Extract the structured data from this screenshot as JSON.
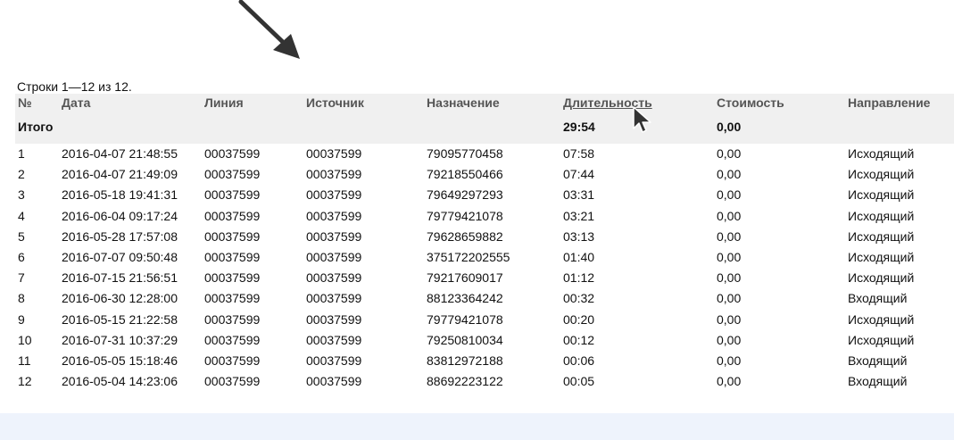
{
  "report": {
    "rows_info": "Строки 1—12 из 12.",
    "columns": [
      "№",
      "Дата",
      "Линия",
      "Источник",
      "Назначение",
      "Длительность",
      "Стоимость",
      "Направление"
    ],
    "sorted_by": "Длительность",
    "totals": {
      "label": "Итого",
      "duration": "29:54",
      "cost": "0,00"
    },
    "rows": [
      {
        "num": "1",
        "date": "2016-04-07 21:48:55",
        "line": "00037599",
        "source": "00037599",
        "dest": "79095770458",
        "duration": "07:58",
        "cost": "0,00",
        "direction": "Исходящий"
      },
      {
        "num": "2",
        "date": "2016-04-07 21:49:09",
        "line": "00037599",
        "source": "00037599",
        "dest": "79218550466",
        "duration": "07:44",
        "cost": "0,00",
        "direction": "Исходящий"
      },
      {
        "num": "3",
        "date": "2016-05-18 19:41:31",
        "line": "00037599",
        "source": "00037599",
        "dest": "79649297293",
        "duration": "03:31",
        "cost": "0,00",
        "direction": "Исходящий"
      },
      {
        "num": "4",
        "date": "2016-06-04 09:17:24",
        "line": "00037599",
        "source": "00037599",
        "dest": "79779421078",
        "duration": "03:21",
        "cost": "0,00",
        "direction": "Исходящий"
      },
      {
        "num": "5",
        "date": "2016-05-28 17:57:08",
        "line": "00037599",
        "source": "00037599",
        "dest": "79628659882",
        "duration": "03:13",
        "cost": "0,00",
        "direction": "Исходящий"
      },
      {
        "num": "6",
        "date": "2016-07-07 09:50:48",
        "line": "00037599",
        "source": "00037599",
        "dest": "375172202555",
        "duration": "01:40",
        "cost": "0,00",
        "direction": "Исходящий"
      },
      {
        "num": "7",
        "date": "2016-07-15 21:56:51",
        "line": "00037599",
        "source": "00037599",
        "dest": "79217609017",
        "duration": "01:12",
        "cost": "0,00",
        "direction": "Исходящий"
      },
      {
        "num": "8",
        "date": "2016-06-30 12:28:00",
        "line": "00037599",
        "source": "00037599",
        "dest": "88123364242",
        "duration": "00:32",
        "cost": "0,00",
        "direction": "Входящий"
      },
      {
        "num": "9",
        "date": "2016-05-15 21:22:58",
        "line": "00037599",
        "source": "00037599",
        "dest": "79779421078",
        "duration": "00:20",
        "cost": "0,00",
        "direction": "Исходящий"
      },
      {
        "num": "10",
        "date": "2016-07-31 10:37:29",
        "line": "00037599",
        "source": "00037599",
        "dest": "79250810034",
        "duration": "00:12",
        "cost": "0,00",
        "direction": "Исходящий"
      },
      {
        "num": "11",
        "date": "2016-05-05 15:18:46",
        "line": "00037599",
        "source": "00037599",
        "dest": "83812972188",
        "duration": "00:06",
        "cost": "0,00",
        "direction": "Входящий"
      },
      {
        "num": "12",
        "date": "2016-05-04 14:23:06",
        "line": "00037599",
        "source": "00037599",
        "dest": "88692223122",
        "duration": "00:05",
        "cost": "0,00",
        "direction": "Входящий"
      }
    ]
  },
  "icons": {
    "annotation": "arrow-down-right-icon",
    "pointer": "mouse-pointer-icon"
  },
  "colors": {
    "header_bg": "#f0f0f0",
    "header_text": "#555555",
    "footer_band": "#eef3fc",
    "arrow": "#333333"
  }
}
